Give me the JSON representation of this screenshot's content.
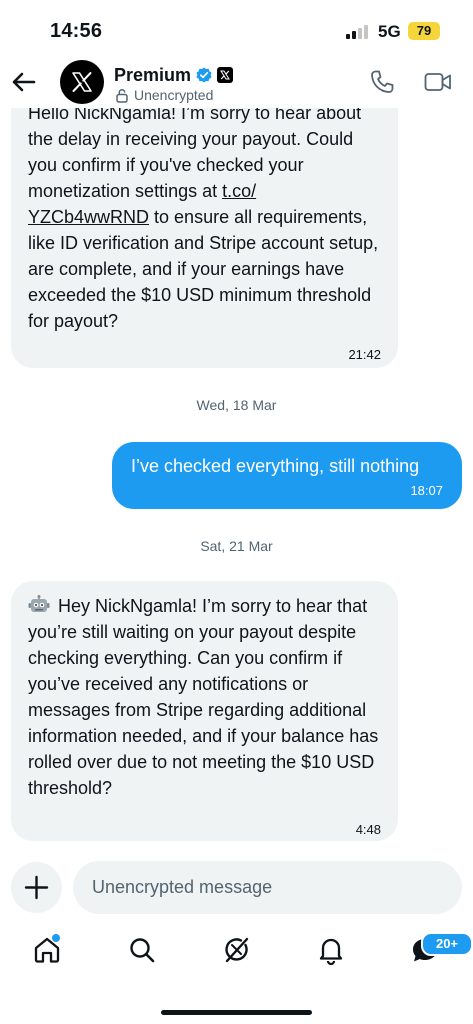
{
  "status_bar": {
    "time": "14:56",
    "network": "5G",
    "battery": "79"
  },
  "header": {
    "name": "Premium",
    "encryption_status": "Unencrypted"
  },
  "messages": [
    {
      "direction": "incoming",
      "parts": [
        "Hello NickNgamla! I’m sorry to hear about the delay in receiving your payout. Could you confirm if you've checked your monetization settings at ",
        "t.co/\nYZCb4wwRND",
        " to ensure all requirements, like ID verification and Stripe account setup, are complete, and if your earnings have exceeded the $10 USD minimum threshold for payout?"
      ],
      "time": "21:42"
    },
    {
      "direction": "date",
      "label": "Wed, 18 Mar"
    },
    {
      "direction": "outgoing",
      "text": "I’ve checked everything, still nothing",
      "time": "18:07"
    },
    {
      "direction": "date",
      "label": "Sat, 21 Mar"
    },
    {
      "direction": "incoming",
      "text": "Hey NickNgamla! I’m sorry to hear that you’re still waiting on your payout despite checking everything. Can you confirm if you’ve received any notifications or messages from Stripe regarding additional information needed, and if your balance has rolled over due to not meeting the $10 USD threshold?",
      "time": "4:48"
    }
  ],
  "composer": {
    "placeholder": "Unencrypted message"
  },
  "bottom_nav": {
    "items": [
      "home-icon",
      "search-icon",
      "grok-icon",
      "notifications-icon",
      "messages-icon"
    ],
    "messages_badge": "20+"
  },
  "colors": {
    "accent": "#1d9bf0",
    "incoming_bubble": "#eff3f4",
    "muted_text": "#536471",
    "battery": "#f6d53a"
  }
}
